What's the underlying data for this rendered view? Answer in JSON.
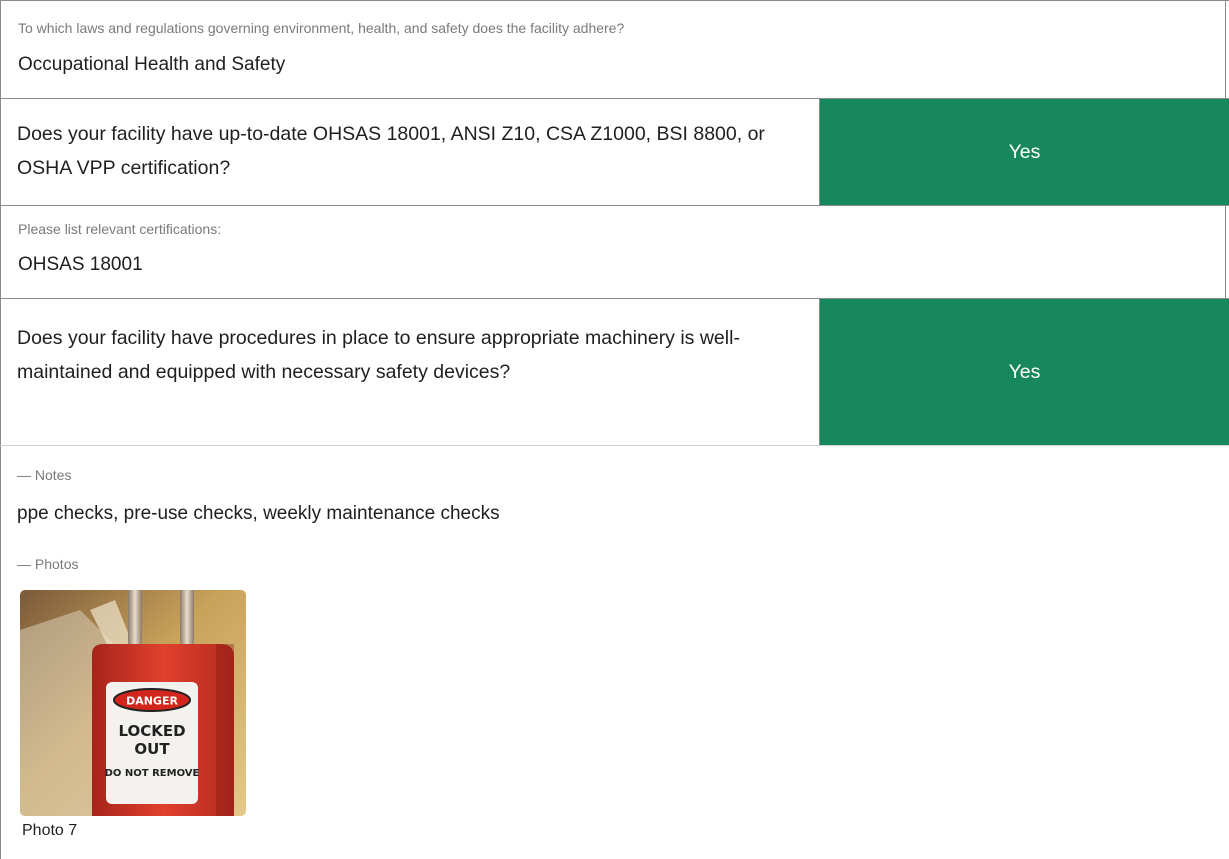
{
  "section_laws": {
    "question": "To which laws and regulations governing environment, health, and safety does the facility adhere?",
    "answer": "Occupational Health and Safety"
  },
  "q_certification": {
    "question": "Does your facility have up-to-date OHSAS 18001, ANSI Z10, CSA Z1000, BSI 8800, or OSHA VPP certification?",
    "answer": "Yes",
    "answer_color": "#17875d"
  },
  "section_certs": {
    "question": "Please list relevant certifications:",
    "answer": "OHSAS 18001"
  },
  "q_machinery": {
    "question": "Does your facility have procedures in place to ensure appropriate machinery is well-maintained and equipped with necessary safety devices?",
    "answer": "Yes",
    "answer_color": "#17875d"
  },
  "notes": {
    "label": "— Notes",
    "text": "ppe checks, pre-use checks, weekly maintenance checks"
  },
  "photos": {
    "label": "— Photos",
    "items": [
      {
        "caption": "Photo 7",
        "image_icon": "lockout-padlock-photo",
        "tag_lines": [
          "DANGER",
          "LOCKED",
          "OUT",
          "DO NOT REMOVE"
        ]
      }
    ]
  }
}
